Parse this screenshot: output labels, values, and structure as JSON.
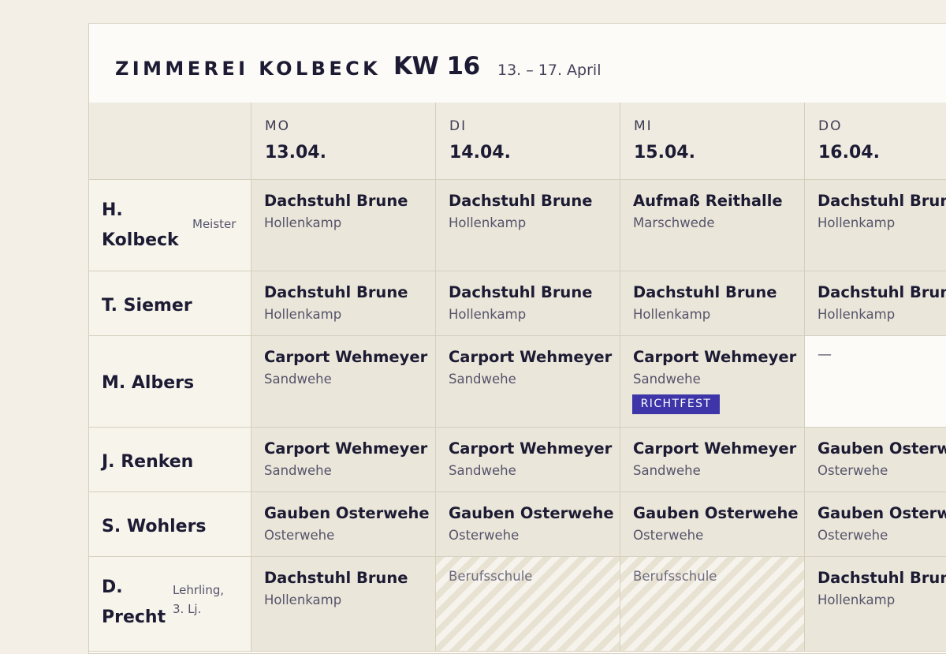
{
  "header": {
    "company": "ZIMMEREI KOLBECK",
    "week": "KW 16",
    "range": "13. – 17. April"
  },
  "days": [
    {
      "abbr": "MO",
      "date": "13.04."
    },
    {
      "abbr": "DI",
      "date": "14.04."
    },
    {
      "abbr": "MI",
      "date": "15.04."
    },
    {
      "abbr": "DO",
      "date": "16.04."
    }
  ],
  "rows": [
    {
      "name": "H. Kolbeck",
      "name_lines": [
        "H.",
        "Kolbeck"
      ],
      "role": "Meister",
      "cells": [
        {
          "kind": "job",
          "project": "Dachstuhl Brune",
          "location": "Hollenkamp"
        },
        {
          "kind": "job",
          "project": "Dachstuhl Brune",
          "location": "Hollenkamp"
        },
        {
          "kind": "job",
          "project": "Aufmaß Reithalle",
          "location": "Marschwede"
        },
        {
          "kind": "job",
          "project": "Dachstuhl Brune",
          "location": "Hollenkamp"
        }
      ]
    },
    {
      "name": "T. Siemer",
      "name_lines": [
        "T. Siemer"
      ],
      "role": "",
      "cells": [
        {
          "kind": "job",
          "project": "Dachstuhl Brune",
          "location": "Hollenkamp"
        },
        {
          "kind": "job",
          "project": "Dachstuhl Brune",
          "location": "Hollenkamp"
        },
        {
          "kind": "job",
          "project": "Dachstuhl Brune",
          "location": "Hollenkamp"
        },
        {
          "kind": "job",
          "project": "Dachstuhl Brune",
          "location": "Hollenkamp"
        }
      ]
    },
    {
      "name": "M. Albers",
      "name_lines": [
        "M. Albers"
      ],
      "role": "",
      "cells": [
        {
          "kind": "job",
          "project": "Carport Wehmeyer",
          "location": "Sandwehe"
        },
        {
          "kind": "job",
          "project": "Carport Wehmeyer",
          "location": "Sandwehe"
        },
        {
          "kind": "job",
          "project": "Carport Wehmeyer",
          "location": "Sandwehe",
          "badge": "RICHTFEST"
        },
        {
          "kind": "empty",
          "text": "—"
        }
      ]
    },
    {
      "name": "J. Renken",
      "name_lines": [
        "J. Renken"
      ],
      "role": "",
      "cells": [
        {
          "kind": "job",
          "project": "Carport Wehmeyer",
          "location": "Sandwehe"
        },
        {
          "kind": "job",
          "project": "Carport Wehmeyer",
          "location": "Sandwehe"
        },
        {
          "kind": "job",
          "project": "Carport Wehmeyer",
          "location": "Sandwehe"
        },
        {
          "kind": "job",
          "project": "Gauben Osterwehe",
          "location": "Osterwehe"
        }
      ]
    },
    {
      "name": "S. Wohlers",
      "name_lines": [
        "S. Wohlers"
      ],
      "role": "",
      "cells": [
        {
          "kind": "job",
          "project": "Gauben Osterwehe",
          "location": "Osterwehe"
        },
        {
          "kind": "job",
          "project": "Gauben Osterwehe",
          "location": "Osterwehe"
        },
        {
          "kind": "job",
          "project": "Gauben Osterwehe",
          "location": "Osterwehe"
        },
        {
          "kind": "job",
          "project": "Gauben Osterwehe",
          "location": "Osterwehe"
        }
      ]
    },
    {
      "name": "D. Precht",
      "name_lines": [
        "D.",
        "Precht"
      ],
      "role": "Lehrling, 3. Lj.",
      "role_lines": [
        "Lehrling,",
        "3. Lj."
      ],
      "cells": [
        {
          "kind": "job",
          "project": "Dachstuhl Brune",
          "location": "Hollenkamp"
        },
        {
          "kind": "school",
          "text": "Berufsschule"
        },
        {
          "kind": "school",
          "text": "Berufsschule"
        },
        {
          "kind": "job",
          "project": "Dachstuhl Brune",
          "location": "Hollenkamp"
        }
      ]
    }
  ]
}
